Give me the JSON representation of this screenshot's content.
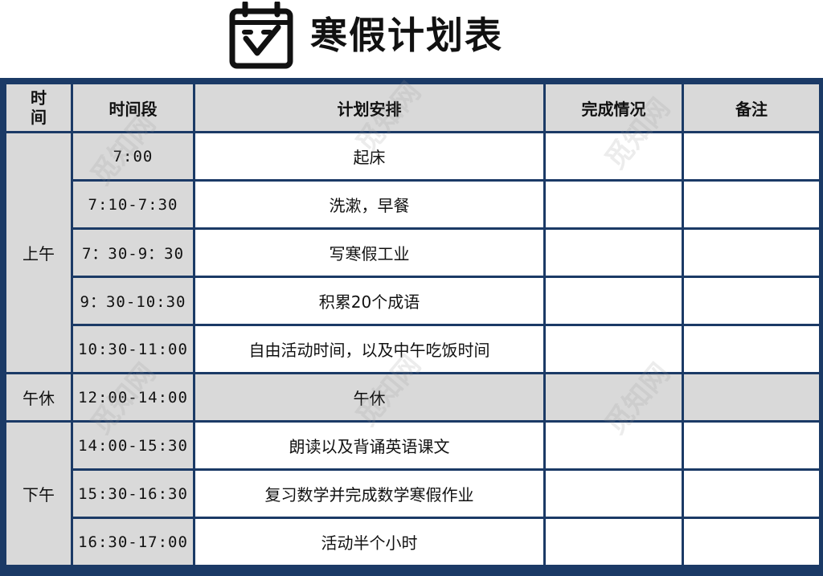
{
  "title": "寒假计划表",
  "title_icon": "calendar-check-icon",
  "colors": {
    "border": "#1b3a66",
    "header_bg": "#d9d9d9",
    "cell_bg": "#ffffff"
  },
  "table": {
    "headers": [
      "时\n间",
      "时间段",
      "计划安排",
      "完成情况",
      "备注"
    ],
    "periods": [
      {
        "label": "上午",
        "rows": [
          {
            "time": "7:00",
            "plan": "起床",
            "status": "",
            "note": ""
          },
          {
            "time": "7:10-7:30",
            "plan": "洗漱，早餐",
            "status": "",
            "note": ""
          },
          {
            "time": "7：30-9：30",
            "plan": "写寒假工业",
            "status": "",
            "note": ""
          },
          {
            "time": "9：30-10:30",
            "plan": "积累20个成语",
            "status": "",
            "note": ""
          },
          {
            "time": "10:30-11:00",
            "plan": "自由活动时间，以及中午吃饭时间",
            "status": "",
            "note": ""
          }
        ]
      },
      {
        "label": "午休",
        "rows": [
          {
            "time": "12:00-14:00",
            "plan": "午休",
            "status": "",
            "note": ""
          }
        ]
      },
      {
        "label": "下午",
        "rows": [
          {
            "time": "14:00-15:30",
            "plan": "朗读以及背诵英语课文",
            "status": "",
            "note": ""
          },
          {
            "time": "15:30-16:30",
            "plan": "复习数学并完成数学寒假作业",
            "status": "",
            "note": ""
          },
          {
            "time": "16:30-17:00",
            "plan": "活动半个小时",
            "status": "",
            "note": ""
          }
        ]
      }
    ]
  },
  "watermark": "觅知网"
}
